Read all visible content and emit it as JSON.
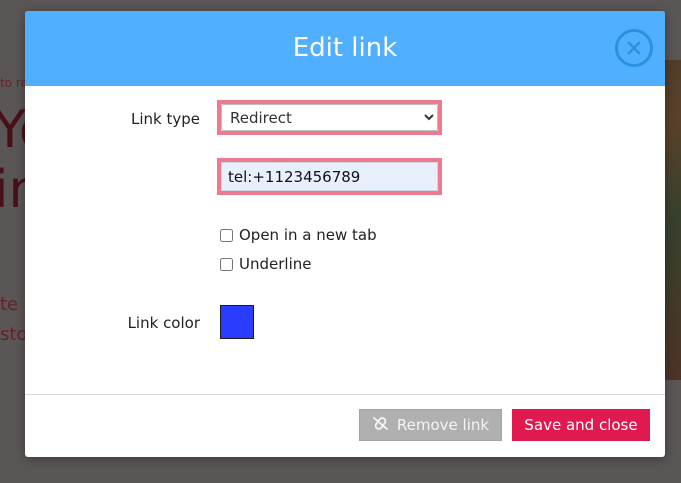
{
  "background_page": {
    "fragment_small": "to re",
    "fragment_big_1": "Yo",
    "fragment_big_2": "in",
    "fragment_mid_1": "te",
    "fragment_mid_2": "sto"
  },
  "dialog": {
    "title": "Edit link",
    "close_icon": "close-icon",
    "header_color": "#50b0ff",
    "fields": {
      "link_type_label": "Link type",
      "link_type_selected": "Redirect",
      "link_type_options": [
        "Redirect"
      ],
      "url_value": "tel:+1123456789",
      "open_new_tab_label": "Open in a new tab",
      "open_new_tab_checked": false,
      "underline_label": "Underline",
      "underline_checked": false,
      "link_color_label": "Link color",
      "link_color_value": "#2a3cff"
    },
    "footer": {
      "remove_label": "Remove link",
      "remove_icon": "unlink-icon",
      "save_label": "Save and close",
      "save_color": "#e0194f"
    }
  }
}
